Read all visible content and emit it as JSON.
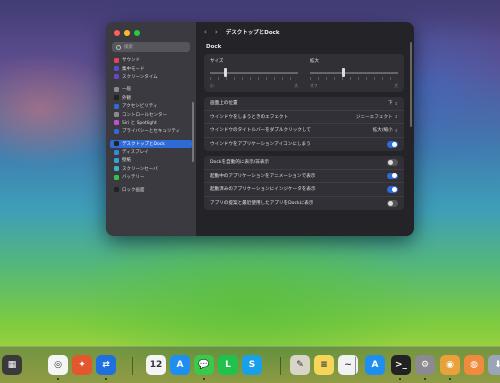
{
  "window": {
    "title": "デスクトップとDock",
    "search_placeholder": "検索"
  },
  "sidebar": {
    "items": [
      {
        "label": "サウンド",
        "icon": "sound-icon",
        "color": "#e2455a"
      },
      {
        "label": "集中モード",
        "icon": "focus-icon",
        "color": "#5b4bd6"
      },
      {
        "label": "スクリーンタイム",
        "icon": "screentime-icon",
        "color": "#6a45c9"
      },
      {
        "label": "一般",
        "icon": "gear-icon",
        "color": "#8a8a90"
      },
      {
        "label": "外観",
        "icon": "appearance-icon",
        "color": "#222"
      },
      {
        "label": "アクセシビリティ",
        "icon": "accessibility-icon",
        "color": "#2f6bd6"
      },
      {
        "label": "コントロールセンター",
        "icon": "control-center-icon",
        "color": "#8a8a90"
      },
      {
        "label": "Siri と Spotlight",
        "icon": "siri-icon",
        "color": "#c04fd6"
      },
      {
        "label": "プライバシーとセキュリティ",
        "icon": "privacy-icon",
        "color": "#2f6bd6"
      },
      {
        "label": "デスクトップとDock",
        "icon": "dock-icon",
        "color": "#222",
        "active": true
      },
      {
        "label": "ディスプレイ",
        "icon": "display-icon",
        "color": "#2f8be0"
      },
      {
        "label": "壁紙",
        "icon": "wallpaper-icon",
        "color": "#35a3d9"
      },
      {
        "label": "スクリーンセーバ",
        "icon": "screensaver-icon",
        "color": "#3ab5c9"
      },
      {
        "label": "バッテリー",
        "icon": "battery-icon",
        "color": "#3cbf4a"
      },
      {
        "label": "ロック画面",
        "icon": "lock-icon",
        "color": "#222"
      }
    ]
  },
  "main": {
    "section_title": "Dock",
    "size_label": "サイズ",
    "size_min": "小",
    "size_max": "大",
    "size_value": 0.18,
    "magnify_label": "拡大",
    "magnify_min": "オフ",
    "magnify_max": "大",
    "magnify_value": 0.38,
    "rows_group1": [
      {
        "label": "画面上の位置",
        "control": "popup",
        "value": "下"
      },
      {
        "label": "ウインドウをしまうときのエフェクト",
        "control": "popup",
        "value": "ジニーエフェクト"
      },
      {
        "label": "ウインドウのタイトルバーをダブルクリックして",
        "control": "popup",
        "value": "拡大/縮小"
      },
      {
        "label": "ウインドウをアプリケーションアイコンにしまう",
        "control": "toggle",
        "on": true
      }
    ],
    "rows_group2": [
      {
        "label": "Dockを自動的に表示/非表示",
        "control": "toggle",
        "on": false
      },
      {
        "label": "起動中のアプリケーションをアニメーションで表示",
        "control": "toggle",
        "on": true
      },
      {
        "label": "起動済みのアプリケーションにインジケータを表示",
        "control": "toggle",
        "on": true
      },
      {
        "label": "アプリの提案と最近使用したアプリをDockに表示",
        "control": "toggle",
        "on": false
      }
    ]
  },
  "dock": {
    "apps": [
      {
        "icon": "photos-icon",
        "color": "#3a3a3a",
        "glyph": "▦"
      },
      {
        "icon": "safari-icon",
        "color": "#f5f5f5",
        "glyph": "◎"
      },
      {
        "icon": "compass-icon",
        "color": "#e4572e",
        "glyph": "✦"
      },
      {
        "icon": "teamviewer-icon",
        "color": "#1e6fe0",
        "glyph": "⇄"
      },
      {
        "icon": "calendar-icon",
        "color": "#f4f4f4",
        "glyph": "12"
      },
      {
        "icon": "appstore-icon",
        "color": "#1e8ff0",
        "glyph": "A"
      },
      {
        "icon": "messages-icon",
        "color": "#3ac94a",
        "glyph": "💬"
      },
      {
        "icon": "line-icon",
        "color": "#21c14e",
        "glyph": "L"
      },
      {
        "icon": "skype-icon",
        "color": "#1aa0e8",
        "glyph": "S"
      },
      {
        "icon": "preview-icon",
        "color": "#d9d4c8",
        "glyph": "✎"
      },
      {
        "icon": "notes-icon",
        "color": "#f6d65a",
        "glyph": "≡"
      },
      {
        "icon": "freeform-icon",
        "color": "#f2f2f2",
        "glyph": "~"
      },
      {
        "icon": "appstore2-icon",
        "color": "#1e8ff0",
        "glyph": "A"
      },
      {
        "icon": "terminal-icon",
        "color": "#222",
        "glyph": ">_"
      },
      {
        "icon": "settings-icon",
        "color": "#8a8a90",
        "glyph": "⚙"
      },
      {
        "icon": "finder-icon",
        "color": "#e9a23b",
        "glyph": "◉"
      },
      {
        "icon": "launchpad-icon",
        "color": "#f08a3c",
        "glyph": "◍"
      },
      {
        "icon": "downloads-icon",
        "color": "#9aa6b8",
        "glyph": "⬇"
      }
    ]
  }
}
